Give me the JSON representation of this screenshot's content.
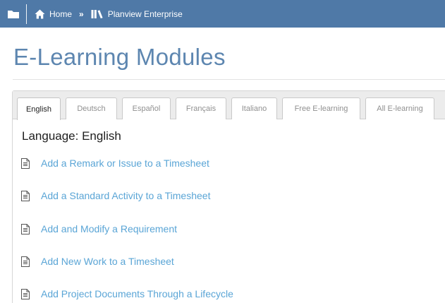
{
  "nav": {
    "home_label": "Home",
    "chevron": "»",
    "app_label": "Planview Enterprise",
    "icons": {
      "folder": "folder-icon",
      "home": "home-icon",
      "library": "library-icon"
    }
  },
  "page": {
    "title": "E-Learning Modules"
  },
  "tabs": [
    {
      "label": "English",
      "active": true
    },
    {
      "label": "Deutsch",
      "active": false
    },
    {
      "label": "Español",
      "active": false
    },
    {
      "label": "Français",
      "active": false
    },
    {
      "label": "Italiano",
      "active": false
    },
    {
      "label": "Free E-learning",
      "active": false
    },
    {
      "label": "All E-learning",
      "active": false
    }
  ],
  "content": {
    "heading": "Language: English",
    "modules": [
      {
        "title": "Add a Remark or Issue to a Timesheet",
        "icon": "document-icon"
      },
      {
        "title": "Add a Standard Activity to a Timesheet",
        "icon": "document-icon"
      },
      {
        "title": "Add and Modify a Requirement",
        "icon": "document-icon"
      },
      {
        "title": "Add New Work to a Timesheet",
        "icon": "document-icon"
      },
      {
        "title": "Add Project Documents Through a Lifecycle",
        "icon": "document-icon"
      }
    ]
  },
  "colors": {
    "nav_bg": "#4f79a7",
    "title": "#5d86b0",
    "link": "#5aa5d6"
  }
}
